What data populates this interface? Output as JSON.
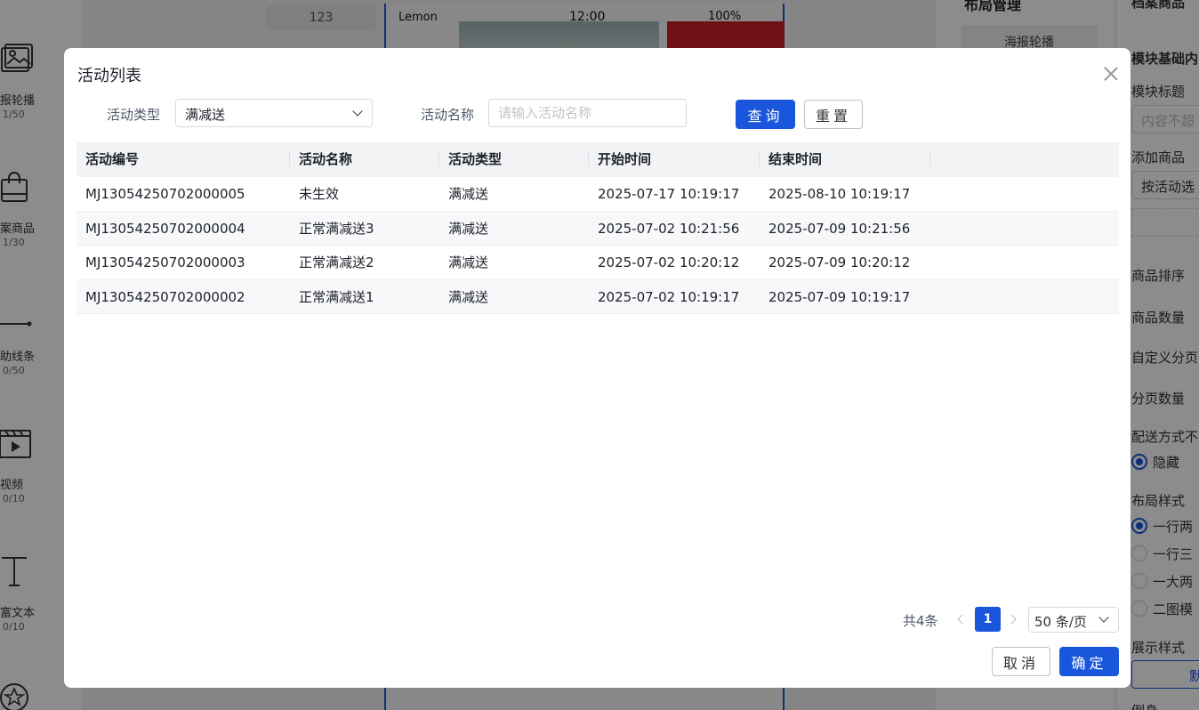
{
  "left_rail": {
    "items": [
      {
        "label": "报轮播",
        "count": "1/50",
        "icon": "image-carousel-icon"
      },
      {
        "label": "案商品",
        "count": "1/30",
        "icon": "shopping-bag-icon"
      },
      {
        "label": "助线条",
        "count": "0/50",
        "icon": "divider-line-icon"
      },
      {
        "label": "视频",
        "count": "0/10",
        "icon": "video-clapper-icon"
      },
      {
        "label": "富文本",
        "count": "0/10",
        "icon": "text-t-icon"
      }
    ]
  },
  "canvas": {
    "counter": "123",
    "phone": {
      "carrier": "Lemon",
      "time": "12:00",
      "battery": "100%"
    }
  },
  "layout_panel": {
    "title": "布局管理",
    "button": "海报轮播"
  },
  "props_panel": {
    "title": "档案商品",
    "section": "模块基础内",
    "module_title_label": "模块标题",
    "module_title_placeholder": "内容不超",
    "add_goods_label": "添加商品",
    "add_goods_value": "按活动选",
    "sort_label": "商品排序",
    "count_label": "商品数量",
    "custom_page_label": "自定义分页",
    "page_count_label": "分页数量",
    "delivery_label": "配送方式不",
    "delivery_option": "隐藏",
    "layout_label": "布局样式",
    "layout_options": [
      "一行两",
      "一行三",
      "一大两",
      "二图模"
    ],
    "display_label": "展示样式",
    "display_value": "默",
    "example_label": "例身"
  },
  "modal": {
    "title": "活动列表",
    "filters": {
      "type_label": "活动类型",
      "type_value": "满减送",
      "name_label": "活动名称",
      "name_placeholder": "请输入活动名称"
    },
    "query_button": "查询",
    "reset_button": "重置",
    "columns": [
      "活动编号",
      "活动名称",
      "活动类型",
      "开始时间",
      "结束时间"
    ],
    "rows": [
      [
        "MJ13054250702000005",
        "未生效",
        "满减送",
        "2025-07-17 10:19:17",
        "2025-08-10 10:19:17"
      ],
      [
        "MJ13054250702000004",
        "正常满减送3",
        "满减送",
        "2025-07-02 10:21:56",
        "2025-07-09 10:21:56"
      ],
      [
        "MJ13054250702000003",
        "正常满减送2",
        "满减送",
        "2025-07-02 10:20:12",
        "2025-07-09 10:20:12"
      ],
      [
        "MJ13054250702000002",
        "正常满减送1",
        "满减送",
        "2025-07-02 10:19:17",
        "2025-07-09 10:19:17"
      ]
    ],
    "pagination": {
      "total": "共4条",
      "current_page": "1",
      "page_size": "50 条/页"
    },
    "cancel_button": "取消",
    "confirm_button": "确定"
  },
  "colors": {
    "primary": "#1a56db",
    "header_bg": "#f2f3f5",
    "mask": "rgba(0,0,0,0.45)"
  }
}
